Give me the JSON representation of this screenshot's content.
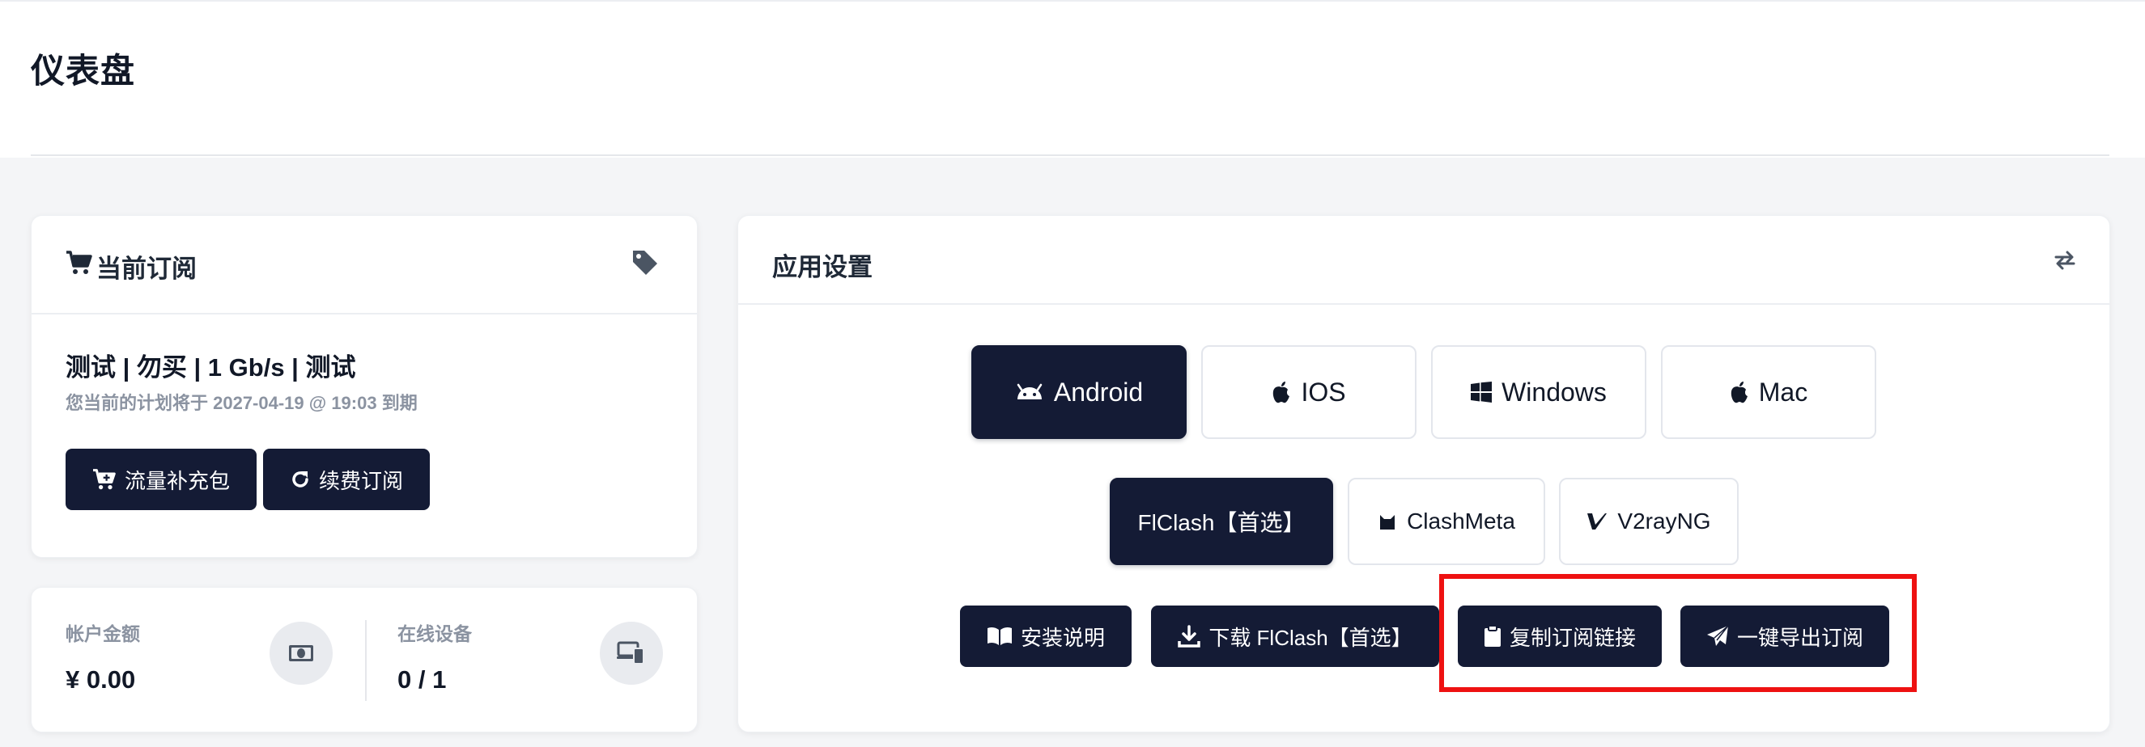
{
  "page": {
    "title": "仪表盘"
  },
  "subscription": {
    "title": "当前订阅",
    "plan_name": "测试 | 勿买 | 1 Gb/s | 测试",
    "expire_text": "您当前的计划将于 2027-04-19 @ 19:03 到期",
    "buttons": {
      "traffic_pack": "流量补充包",
      "renew": "续费订阅"
    }
  },
  "account": {
    "balance_label": "帐户金额",
    "balance_value": "¥ 0.00",
    "devices_label": "在线设备",
    "devices_value": "0 / 1"
  },
  "app_settings": {
    "title": "应用设置",
    "platforms": [
      {
        "label": "Android",
        "icon": "android-icon",
        "active": true
      },
      {
        "label": "IOS",
        "icon": "apple-icon",
        "active": false
      },
      {
        "label": "Windows",
        "icon": "windows-icon",
        "active": false
      },
      {
        "label": "Mac",
        "icon": "apple-icon",
        "active": false
      }
    ],
    "clients": [
      {
        "label": "FlClash【首选】",
        "active": true
      },
      {
        "label": "ClashMeta",
        "icon": "cat-icon",
        "active": false
      },
      {
        "label": "V2rayNG",
        "icon": "v-logo-icon",
        "active": false
      }
    ],
    "actions": {
      "install_guide": "安装说明",
      "download": "下载 FlClash【首选】",
      "copy_link": "复制订阅链接",
      "export": "一键导出订阅"
    }
  },
  "colors": {
    "primary": "#141b35",
    "highlight": "#ee1111",
    "muted": "#8b93a1"
  }
}
